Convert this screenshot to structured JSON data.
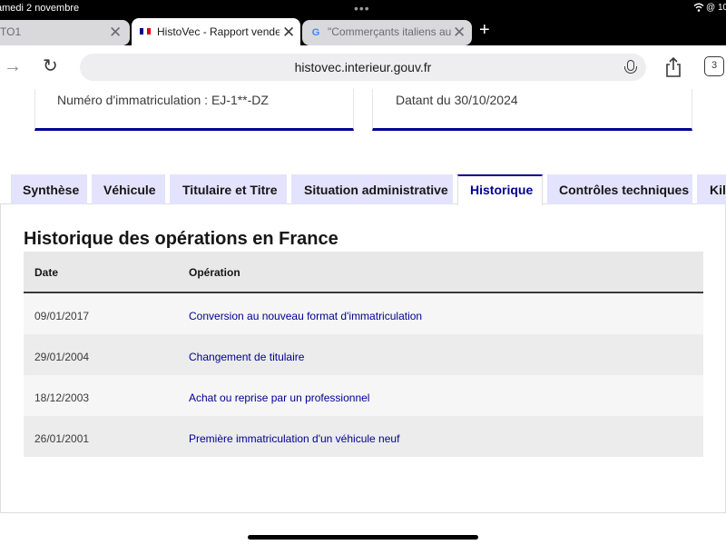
{
  "status_bar": {
    "date": "amedi 2 novembre",
    "dots": "•••",
    "right": "10"
  },
  "browser": {
    "tabs": [
      {
        "title": "TO1"
      },
      {
        "title": "HistoVec - Rapport vendeur"
      },
      {
        "title": "\"Commerçants italiens au…"
      }
    ],
    "new_tab": "+",
    "url": "histovec.interieur.gouv.fr",
    "tab_count": "3",
    "back": "←",
    "forward": "→",
    "reload": "↻",
    "close": "✕",
    "google_glyph": "G"
  },
  "cards": {
    "left": "Numéro d'immatriculation : EJ-1**-DZ",
    "right": "Datant du 30/10/2024"
  },
  "page_tabs": [
    {
      "label": "Synthèse",
      "active": false
    },
    {
      "label": "Véhicule",
      "active": false
    },
    {
      "label": "Titulaire et Titre",
      "active": false
    },
    {
      "label": "Situation administrative",
      "active": false
    },
    {
      "label": "Historique",
      "active": true
    },
    {
      "label": "Contrôles techniques",
      "active": false
    },
    {
      "label": "Kilométrage",
      "active": false
    }
  ],
  "history": {
    "title": "Historique des opérations en France",
    "headers": {
      "date": "Date",
      "operation": "Opération"
    },
    "rows": [
      {
        "date": "09/01/2017",
        "operation": "Conversion au nouveau format d'immatriculation"
      },
      {
        "date": "29/01/2004",
        "operation": "Changement de titulaire"
      },
      {
        "date": "18/12/2003",
        "operation": "Achat ou reprise par un professionnel"
      },
      {
        "date": "26/01/2001",
        "operation": "Première immatriculation d'un véhicule neuf"
      }
    ]
  },
  "colors": {
    "accent": "#000091",
    "tab_bg": "#e3e3fd",
    "row_light": "#f6f6f6",
    "row_dark": "#ececec"
  }
}
